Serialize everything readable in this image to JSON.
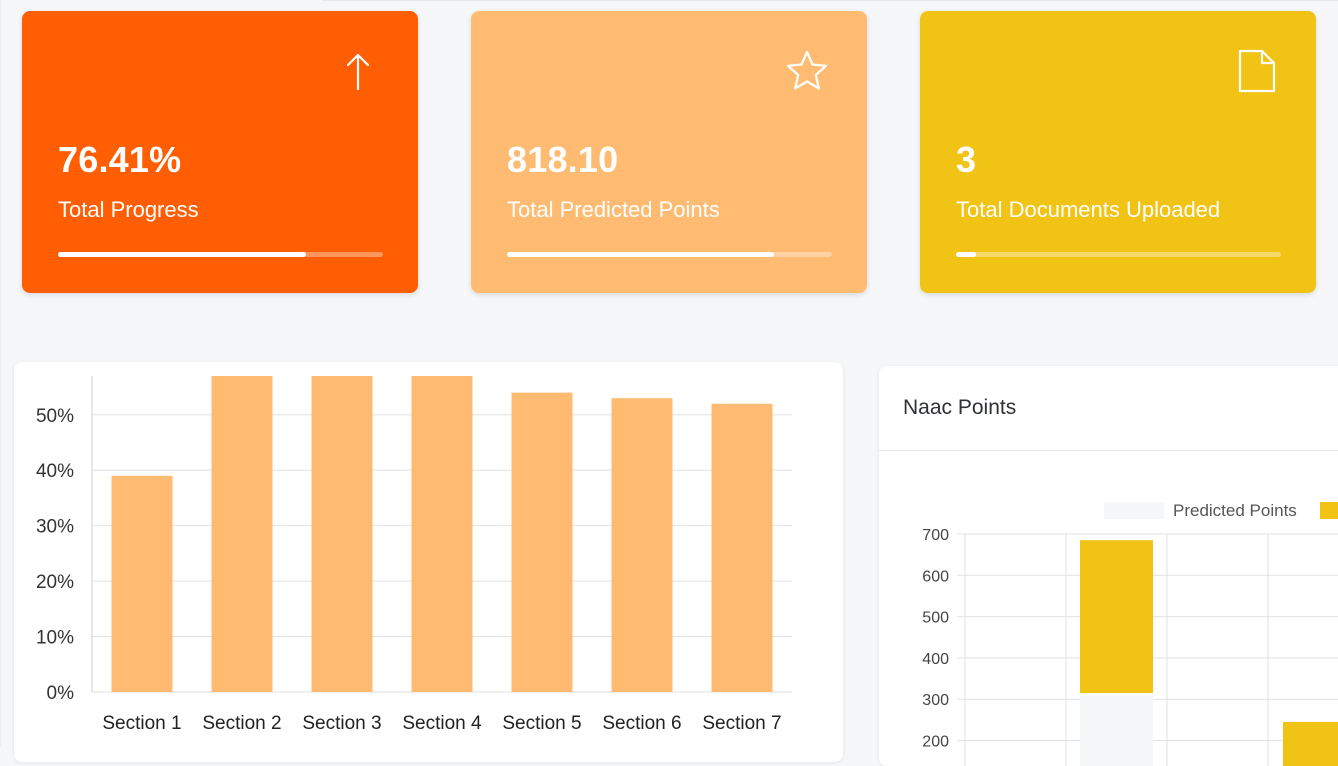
{
  "cards": [
    {
      "value": "76.41%",
      "label": "Total Progress",
      "progress": 0.7641,
      "icon": "arrow-up-icon",
      "color": "#ff5e05"
    },
    {
      "value": "818.10",
      "label": "Total Predicted Points",
      "progress": 0.82,
      "icon": "star-icon",
      "color": "#ffbb72"
    },
    {
      "value": "3",
      "label": "Total Documents Uploaded",
      "progress": 0.06,
      "icon": "document-icon",
      "color": "#f0c314"
    }
  ],
  "naac_panel": {
    "title": "Naac Points"
  },
  "chart_data": [
    {
      "type": "bar",
      "categories": [
        "Section 1",
        "Section 2",
        "Section 3",
        "Section 4",
        "Section 5",
        "Section 6",
        "Section 7"
      ],
      "values": [
        39,
        57,
        57,
        57,
        54,
        53,
        52
      ],
      "ylim": [
        0,
        57
      ],
      "yticks": [
        "0%",
        "10%",
        "20%",
        "30%",
        "40%",
        "50%"
      ],
      "color": "#ffbb72",
      "grid": true
    },
    {
      "type": "bar",
      "title": "",
      "legend": [
        "Predicted Points"
      ],
      "legend_colors": [
        "#f6f7f9",
        "#f0c314"
      ],
      "legend_position": "top-right",
      "yticks": [
        "700",
        "600",
        "500",
        "400",
        "300",
        "200"
      ],
      "visible_bars": [
        {
          "base": 315,
          "top": 685,
          "color": "#f0c314"
        },
        {
          "base": 310,
          "top": 0,
          "color": "#f6f7f9"
        },
        {
          "base": 0,
          "top": 245,
          "color": "#f0c314"
        }
      ],
      "grid": true
    }
  ]
}
